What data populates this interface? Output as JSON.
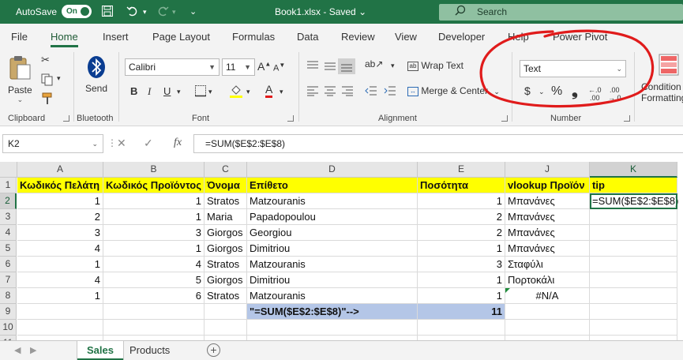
{
  "titlebar": {
    "autosave_label": "AutoSave",
    "autosave_state": "On",
    "filename": "Book1.xlsx - Saved",
    "filename_arrow": "⌄",
    "search_placeholder": "Search"
  },
  "ribbon_tabs": [
    "File",
    "Home",
    "Insert",
    "Page Layout",
    "Formulas",
    "Data",
    "Review",
    "View",
    "Developer",
    "Help",
    "Power Pivot"
  ],
  "ribbon": {
    "paste_label": "Paste",
    "send_label": "Send",
    "font_name": "Calibri",
    "font_size": "11",
    "bold": "B",
    "italic": "I",
    "underline": "U",
    "wrap_text_label": "Wrap Text",
    "merge_center_label": "Merge & Center",
    "number_format": "Text",
    "currency_symbol": "$",
    "percent_symbol": "%",
    "comma_symbol": "❟",
    "conditional_label_1": "Condition",
    "conditional_label_2": "Formatting",
    "groups": {
      "clipboard": "Clipboard",
      "bluetooth": "Bluetooth",
      "font": "Font",
      "alignment": "Alignment",
      "number": "Number"
    }
  },
  "formula_bar": {
    "name_box": "K2",
    "fx": "fx",
    "formula": "=SUM($E$2:$E$8)"
  },
  "columns": [
    "A",
    "B",
    "C",
    "D",
    "E",
    "J",
    "K"
  ],
  "rows": [
    "1",
    "2",
    "3",
    "4",
    "5",
    "6",
    "7",
    "8",
    "9",
    "10",
    "11"
  ],
  "cells": {
    "header": [
      "Κωδικός Πελάτη",
      "Κωδικός Προϊόντος",
      "Όνομα",
      "Επίθετο",
      "Ποσότητα",
      "vlookup Προϊόν",
      "tip"
    ],
    "data": [
      [
        "1",
        "1",
        "Stratos",
        "Matzouranis",
        "1",
        "Μπανάνες",
        "=SUM($E$2:$E$8)"
      ],
      [
        "2",
        "1",
        "Maria",
        "Papadopoulou",
        "2",
        "Μπανάνες",
        ""
      ],
      [
        "3",
        "3",
        "Giorgos",
        "Georgiou",
        "2",
        "Μπανάνες",
        ""
      ],
      [
        "4",
        "1",
        "Giorgos",
        "Dimitriou",
        "1",
        "Μπανάνες",
        ""
      ],
      [
        "1",
        "4",
        "Stratos",
        "Matzouranis",
        "3",
        "Σταφύλι",
        ""
      ],
      [
        "4",
        "5",
        "Giorgos",
        "Dimitriou",
        "1",
        "Πορτοκάλι",
        ""
      ],
      [
        "1",
        "6",
        "Stratos",
        "Matzouranis",
        "1",
        "#N/A",
        ""
      ]
    ],
    "row9_d": "\"=SUM($E$2:$E$8)\"-->",
    "row9_e": "11"
  },
  "sheets": {
    "tabs": [
      "Sales",
      "Products"
    ],
    "active": "Sales",
    "add": "+"
  },
  "colors": {
    "excel_green": "#217346",
    "header_fill": "#ffff00",
    "total_fill": "#b4c6e7",
    "annotation": "#e01b1b"
  }
}
